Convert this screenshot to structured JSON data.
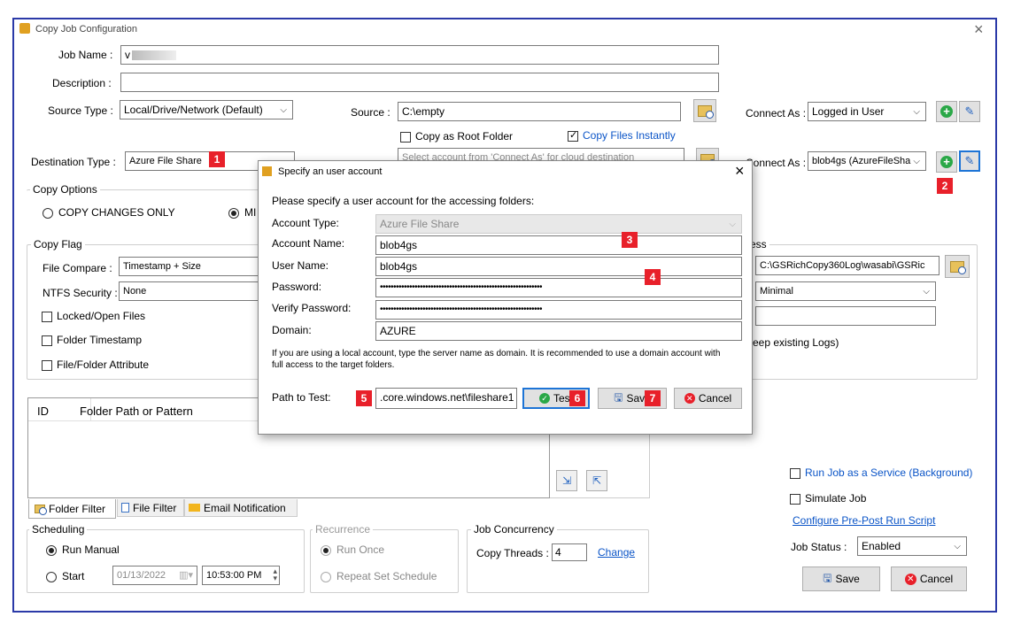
{
  "window": {
    "title": "Copy Job Configuration",
    "close": "×"
  },
  "main": {
    "job_name_label": "Job Name :",
    "job_name_value": "v",
    "description_label": "Description :",
    "source_type_label": "Source Type :",
    "source_type_value": "Local/Drive/Network (Default)",
    "source_label": "Source :",
    "source_value": "C:\\empty",
    "connect_as_label": "Connect As :",
    "connect_as_source": "Logged in User",
    "copy_as_root": "Copy as Root Folder",
    "copy_files_instantly": "Copy Files Instantly",
    "destination_type_label": "Destination Type :",
    "destination_type_value": "Azure File Share",
    "destination_label": "Destination :",
    "destination_placeholder": "Select account from 'Connect As' for cloud destination",
    "connect_as_dest_label": "Connect As :",
    "connect_as_dest": "blob4gs (AzureFileSha"
  },
  "copy_options": {
    "title": "Copy Options",
    "opt1": "COPY CHANGES ONLY",
    "opt2": "MI"
  },
  "copy_flag": {
    "title": "Copy Flag",
    "file_compare_label": "File Compare :",
    "file_compare_value": "Timestamp + Size",
    "ntfs_label": "NTFS Security :",
    "ntfs_value": "None",
    "locked": "Locked/Open Files",
    "folder_ts": "Folder Timestamp",
    "attr": "File/Folder Attribute"
  },
  "right_panel": {
    "group_title": "ess",
    "log_path": "C:\\GSRichCopy360Log\\wasabi\\GSRic",
    "log_level": "Minimal",
    "keep_logs": "eep existing Logs)"
  },
  "table": {
    "col_id": "ID",
    "col_path": "Folder Path or Pattern"
  },
  "tabs": {
    "folder_filter": "Folder Filter",
    "file_filter": "File Filter",
    "email": "Email Notification"
  },
  "scheduling": {
    "title": "Scheduling",
    "run_manual": "Run Manual",
    "start": "Start",
    "date": "01/13/2022",
    "time": "10:53:00 PM"
  },
  "recurrence": {
    "title": "Recurrence",
    "run_once": "Run Once",
    "repeat": "Repeat  Set Schedule"
  },
  "concurrency": {
    "title": "Job Concurrency",
    "threads_label": "Copy Threads :",
    "threads_value": "4",
    "change": "Change"
  },
  "options": {
    "run_as_service": "Run Job as a Service (Background)",
    "simulate": "Simulate Job",
    "pre_post": "Configure Pre-Post Run Script",
    "status_label": "Job Status :",
    "status_value": "Enabled",
    "save": "Save",
    "cancel": "Cancel"
  },
  "dialog": {
    "title": "Specify an user account",
    "close": "×",
    "prompt": "Please specify a user account for the accessing folders:",
    "account_type_label": "Account Type:",
    "account_type_value": "Azure File Share",
    "account_name_label": "Account Name:",
    "account_name_value": "blob4gs",
    "user_name_label": "User Name:",
    "user_name_value": "blob4gs",
    "password_label": "Password:",
    "password_value": "•••••••••••••••••••••••••••••••••••••••••••••••••••••••••••••",
    "verify_label": "Verify Password:",
    "verify_value": "•••••••••••••••••••••••••••••••••••••••••••••••••••••••••••••",
    "domain_label": "Domain:",
    "domain_value": "AZURE",
    "note": "If you are using a local account, type the server name as domain. It is recommended to use a domain account with full access to the target folders.",
    "path_label": "Path to Test:",
    "path_value": ".core.windows.net\\fileshare1",
    "test": "Test",
    "save": "Save",
    "cancel": "Cancel"
  },
  "badges": [
    "1",
    "2",
    "3",
    "4",
    "5",
    "6",
    "7"
  ],
  "colors": {
    "accent": "#0a54c7",
    "badge": "#e8202a",
    "window_border": "#2b3aa8"
  }
}
